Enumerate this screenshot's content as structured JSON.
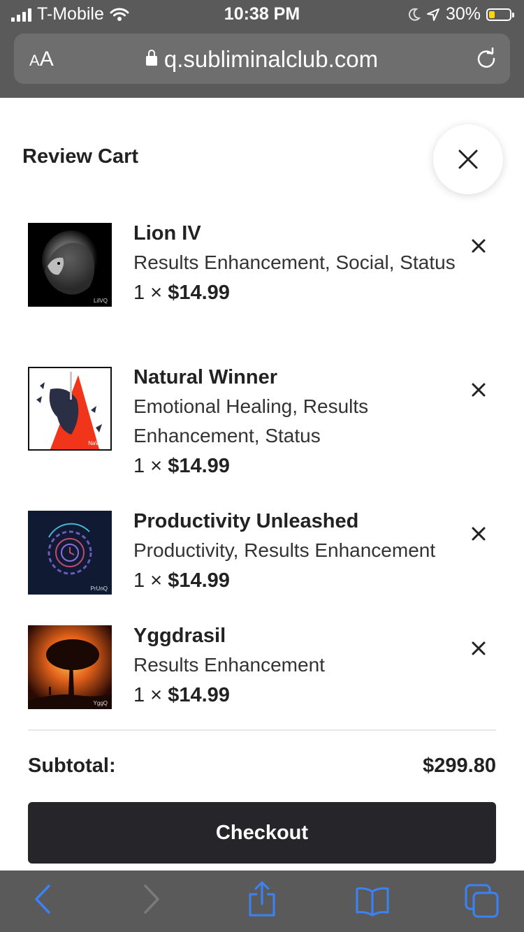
{
  "status_bar": {
    "carrier": "T-Mobile",
    "time": "10:38 PM",
    "battery": "30%",
    "battery_level": 0.3
  },
  "browser": {
    "aa_label_small": "A",
    "aa_label_large": "A",
    "url": "q.subliminalclub.com"
  },
  "cart": {
    "title": "Review Cart",
    "items": [
      {
        "name": "Lion IV",
        "tags": "Results Enhancement, Social, Status",
        "quantity_prefix": "1 × ",
        "price": "$14.99",
        "thumb_tag": "LiIVQ"
      },
      {
        "name": "Natural Winner",
        "tags": "Emotional Healing, Results Enhancement, Status",
        "quantity_prefix": "1 × ",
        "price": "$14.99",
        "thumb_tag": "NaWiQ"
      },
      {
        "name": "Productivity Unleashed",
        "tags": "Productivity, Results Enhancement",
        "quantity_prefix": "1 × ",
        "price": "$14.99",
        "thumb_tag": "PrUnQ"
      },
      {
        "name": "Yggdrasil",
        "tags": "Results Enhancement",
        "quantity_prefix": "1 × ",
        "price": "$14.99",
        "thumb_tag": "YggQ"
      }
    ],
    "subtotal_label": "Subtotal:",
    "subtotal_value": "$299.80",
    "checkout_label": "Checkout"
  },
  "colors": {
    "chrome": "#5a5a5a",
    "toolbar_icon": "#3b82f6",
    "checkout_bg": "#26262a"
  },
  "icons": {
    "close": "close-icon",
    "remove": "x-icon",
    "back": "chevron-left-icon",
    "forward": "chevron-right-icon",
    "share": "share-icon",
    "bookmarks": "book-icon",
    "tabs": "tabs-icon"
  }
}
